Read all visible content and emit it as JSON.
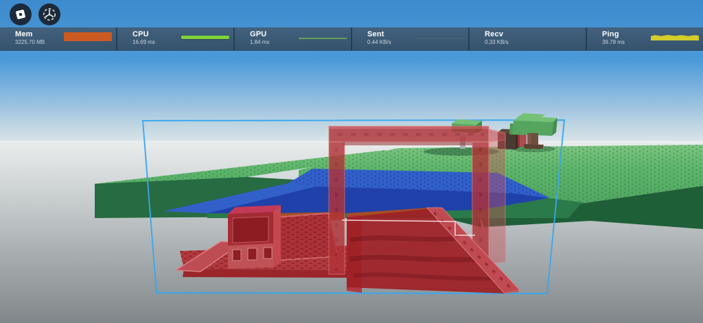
{
  "app": {
    "name": "Roblox",
    "view": "game viewport with performance stats"
  },
  "topbar": {
    "buttons": [
      {
        "id": "roblox-menu",
        "icon": "roblox-logo"
      },
      {
        "id": "view-selector",
        "icon": "orbit-arrows-icon"
      }
    ]
  },
  "stats": {
    "bar_bg": "#3c5a74",
    "cells": [
      {
        "label": "Mem",
        "value": "3225.70 MB",
        "graph_type": "area",
        "graph_color": "#cd5a21"
      },
      {
        "label": "CPU",
        "value": "16.69 ms",
        "graph_type": "bar",
        "graph_color": "#7ed139"
      },
      {
        "label": "GPU",
        "value": "1.84 ms",
        "graph_type": "line",
        "graph_color": "#64a156"
      },
      {
        "label": "Sent",
        "value": "0.44 KB/s",
        "graph_type": "faint-line",
        "graph_color": "#58847a"
      },
      {
        "label": "Recv",
        "value": "0.33 KB/s",
        "graph_type": "none",
        "graph_color": ""
      },
      {
        "label": "Ping",
        "value": "39.78 ms",
        "graph_type": "jagged-area",
        "graph_color": "#d3cd2a"
      }
    ]
  },
  "scene": {
    "description": "3D world: red translucent selected model (arch, ramps, platform, box) inside light-blue selection box, on green studded baseplate with blue water plate, blocky trees and crate at right",
    "colors": {
      "sky_top": "#3d8bcd",
      "sky_horizon": "#e9edee",
      "fog": "#80878a",
      "grass_top": "#58b166",
      "grass_side_left": "#266b41",
      "grass_side": "#1e5f38",
      "grass_strip": "#2a7a4a",
      "water_top": "#3160c8",
      "water_front": "#1d3fa6",
      "red_model": "#b13338",
      "red_deep": "#9e2026",
      "red_light": "#bf4a52",
      "red_magenta": "#c23a58",
      "orange_edge": "#b54a1b",
      "selection": "#38a6ef",
      "leaf": "#55a55e",
      "leaf_top": "#74c177",
      "trunk": "#6e4f40",
      "crate": "#4b3a31",
      "post": "#a8adad",
      "button_bg": "#1d2a3a"
    }
  }
}
